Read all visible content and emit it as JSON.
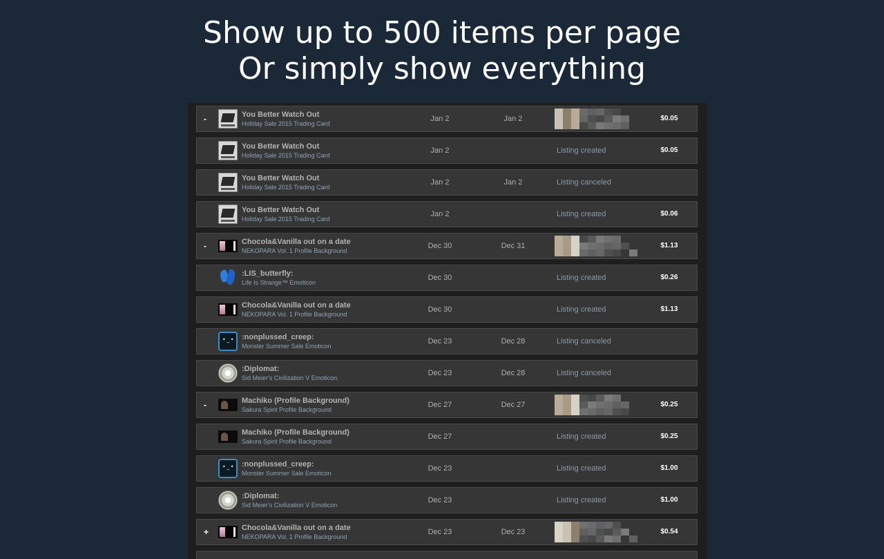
{
  "headline": {
    "line1": "Show up to 500 items per page",
    "line2": "Or simply show everything"
  },
  "rows": [
    {
      "sign": "-",
      "icon": "trading-card-icon",
      "name": "You Better Watch Out",
      "game": "Holiday Sale 2015 Trading Card",
      "listed": "Jan 2",
      "acted": "Jan 2",
      "status": "",
      "buyer": "pixelated-buyer-avatar",
      "price": "$0.05"
    },
    {
      "sign": "",
      "icon": "trading-card-icon",
      "name": "You Better Watch Out",
      "game": "Holiday Sale 2015 Trading Card",
      "listed": "Jan 2",
      "acted": "",
      "status": "Listing created",
      "buyer": "",
      "price": "$0.05"
    },
    {
      "sign": "",
      "icon": "trading-card-icon",
      "name": "You Better Watch Out",
      "game": "Holiday Sale 2015 Trading Card",
      "listed": "Jan 2",
      "acted": "Jan 2",
      "status": "Listing canceled",
      "buyer": "",
      "price": ""
    },
    {
      "sign": "",
      "icon": "trading-card-icon",
      "name": "You Better Watch Out",
      "game": "Holiday Sale 2015 Trading Card",
      "listed": "Jan 2",
      "acted": "",
      "status": "Listing created",
      "buyer": "",
      "price": "$0.06"
    },
    {
      "sign": "-",
      "icon": "profile-background-icon",
      "name": "Chocola&Vanilla out on a date",
      "game": "NEKOPARA Vol. 1 Profile Background",
      "listed": "Dec 30",
      "acted": "Dec 31",
      "status": "",
      "buyer": "pixelated-buyer-avatar",
      "price": "$1.13"
    },
    {
      "sign": "",
      "icon": "butterfly-emoticon-icon",
      "name": ":LIS_butterfly:",
      "game": "Life Is Strange™ Emoticon",
      "listed": "Dec 30",
      "acted": "",
      "status": "Listing created",
      "buyer": "",
      "price": "$0.26"
    },
    {
      "sign": "",
      "icon": "profile-background-icon",
      "name": "Chocola&Vanilla out on a date",
      "game": "NEKOPARA Vol. 1 Profile Background",
      "listed": "Dec 30",
      "acted": "",
      "status": "Listing created",
      "buyer": "",
      "price": "$1.13"
    },
    {
      "sign": "",
      "icon": "creep-emoticon-icon",
      "name": ":nonplussed_creep:",
      "game": "Monster Summer Sale Emoticon",
      "listed": "Dec 23",
      "acted": "Dec 28",
      "status": "Listing canceled",
      "buyer": "",
      "price": ""
    },
    {
      "sign": "",
      "icon": "diplomat-emoticon-icon",
      "name": ":Diplomat:",
      "game": "Sid Meier's Civilization V Emoticon",
      "listed": "Dec 23",
      "acted": "Dec 28",
      "status": "Listing canceled",
      "buyer": "",
      "price": ""
    },
    {
      "sign": "-",
      "icon": "sakura-background-icon",
      "name": "Machiko (Profile Background)",
      "game": "Sakura Spirit Profile Background",
      "listed": "Dec 27",
      "acted": "Dec 27",
      "status": "",
      "buyer": "pixelated-buyer-avatar",
      "price": "$0.25"
    },
    {
      "sign": "",
      "icon": "sakura-background-icon",
      "name": "Machiko (Profile Background)",
      "game": "Sakura Spirit Profile Background",
      "listed": "Dec 27",
      "acted": "",
      "status": "Listing created",
      "buyer": "",
      "price": "$0.25"
    },
    {
      "sign": "",
      "icon": "creep-emoticon-icon",
      "name": ":nonplussed_creep:",
      "game": "Monster Summer Sale Emoticon",
      "listed": "Dec 23",
      "acted": "",
      "status": "Listing created",
      "buyer": "",
      "price": "$1.00"
    },
    {
      "sign": "",
      "icon": "diplomat-emoticon-icon",
      "name": ":Diplomat:",
      "game": "Sid Meier's Civilization V Emoticon",
      "listed": "Dec 23",
      "acted": "",
      "status": "Listing created",
      "buyer": "",
      "price": "$1.00"
    },
    {
      "sign": "+",
      "icon": "profile-background-icon",
      "name": "Chocola&Vanilla out on a date",
      "game": "NEKOPARA Vol. 1 Profile Background",
      "listed": "Dec 23",
      "acted": "Dec 23",
      "status": "",
      "buyer": "pixelated-buyer-avatar",
      "price": "$0.54"
    }
  ],
  "colors": {
    "page_background": "#1b2838",
    "panel_background": "#1e1e1e",
    "row_background": "#363636",
    "item_name": "#b3b3b3",
    "game_name": "#8da3b8",
    "status_text": "#8b9aa8",
    "price_text": "#ffffff"
  }
}
